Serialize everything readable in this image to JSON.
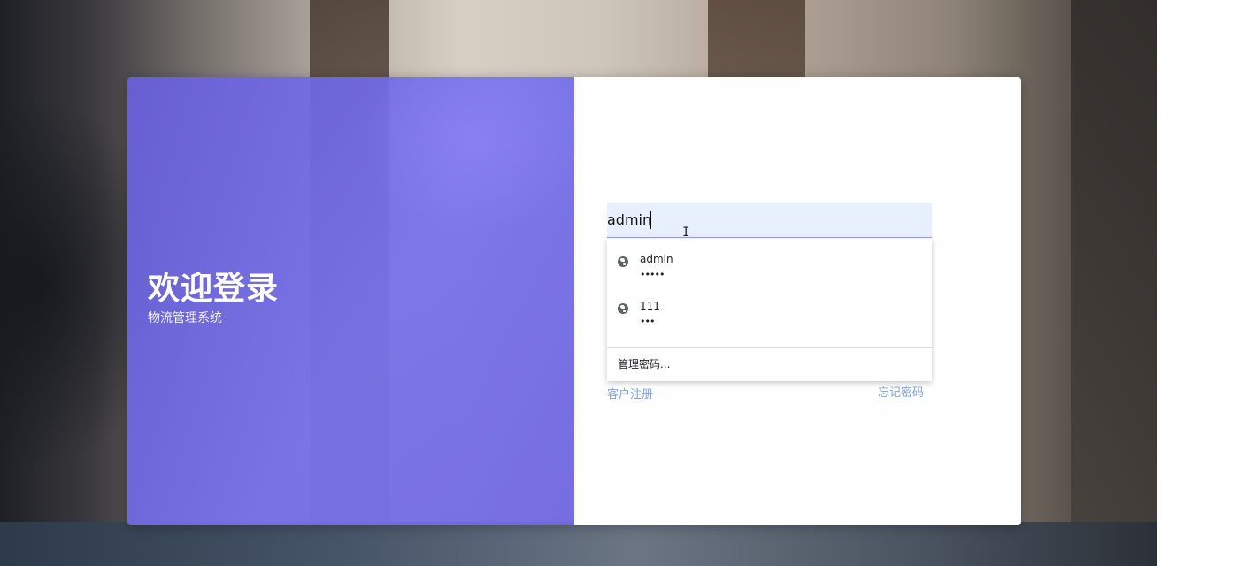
{
  "branding": {
    "title": "欢迎登录",
    "subtitle": "物流管理系统"
  },
  "login": {
    "username_value": "admin"
  },
  "autofill": {
    "icon": "globe-icon",
    "items": [
      {
        "username": "admin",
        "password_mask": "•••••"
      },
      {
        "username": "111",
        "password_mask": "•••"
      }
    ],
    "manage_label": "管理密码..."
  },
  "links": {
    "register": "客户注册",
    "forgot": "忘记密码"
  },
  "colors": {
    "left_panel": "#7470e4",
    "input_bg": "#e8effd",
    "link": "#7ea6df"
  }
}
